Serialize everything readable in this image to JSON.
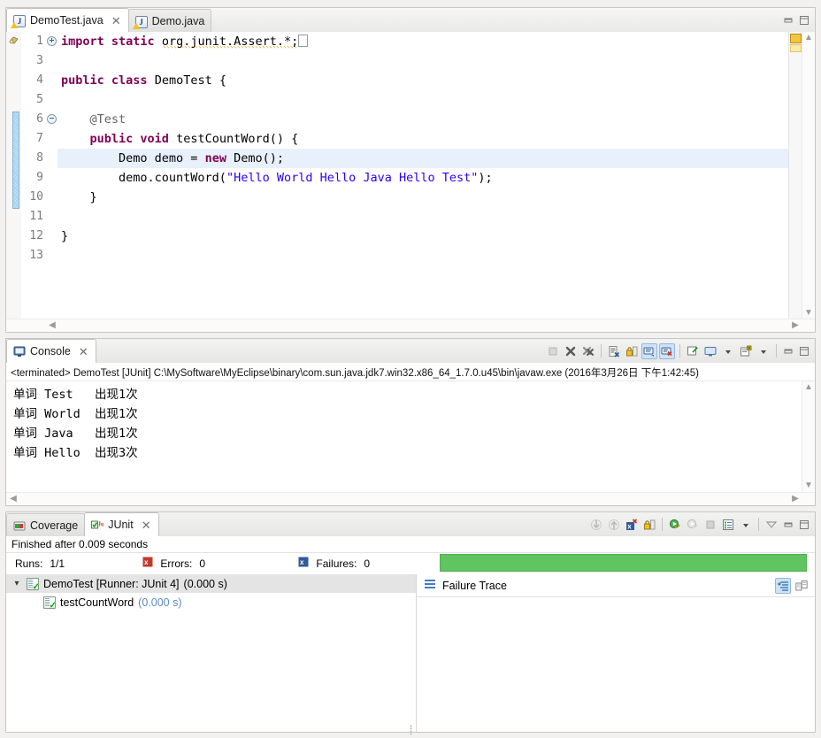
{
  "editor": {
    "tabs": [
      {
        "label": "DemoTest.java",
        "icon": "java-file-warning-icon",
        "active": true,
        "closable": true
      },
      {
        "label": "Demo.java",
        "icon": "java-file-warning-icon",
        "active": false,
        "closable": false
      }
    ],
    "window_buttons": {
      "minimize": "minimize-icon",
      "maximize": "maximize-icon"
    },
    "lines": [
      {
        "num": "1",
        "fold": "plus",
        "tokens": [
          {
            "t": "import ",
            "c": "kw"
          },
          {
            "t": "static ",
            "c": "kw"
          },
          {
            "t": "org.junit.Assert.*;",
            "c": "warn"
          },
          {
            "t": "caret",
            "c": "caret"
          }
        ]
      },
      {
        "num": "3",
        "fold": "",
        "tokens": []
      },
      {
        "num": "4",
        "fold": "",
        "tokens": [
          {
            "t": "public ",
            "c": "kw"
          },
          {
            "t": "class ",
            "c": "kw"
          },
          {
            "t": "DemoTest {",
            "c": "plain"
          }
        ]
      },
      {
        "num": "5",
        "fold": "",
        "tokens": []
      },
      {
        "num": "6",
        "fold": "minus",
        "tokens": [
          {
            "t": "    @Test",
            "c": "ann"
          }
        ]
      },
      {
        "num": "7",
        "fold": "",
        "tokens": [
          {
            "t": "    ",
            "c": "plain"
          },
          {
            "t": "public ",
            "c": "kw"
          },
          {
            "t": "void ",
            "c": "kw"
          },
          {
            "t": "testCountWord() {",
            "c": "plain"
          }
        ]
      },
      {
        "num": "8",
        "fold": "",
        "highlight": true,
        "tokens": [
          {
            "t": "        Demo demo = ",
            "c": "plain"
          },
          {
            "t": "new ",
            "c": "kw"
          },
          {
            "t": "Demo();",
            "c": "plain"
          }
        ]
      },
      {
        "num": "9",
        "fold": "",
        "tokens": [
          {
            "t": "        demo.countWord(",
            "c": "plain"
          },
          {
            "t": "\"Hello World Hello Java Hello Test\"",
            "c": "str"
          },
          {
            "t": ");",
            "c": "plain"
          }
        ]
      },
      {
        "num": "10",
        "fold": "",
        "tokens": [
          {
            "t": "    }",
            "c": "plain"
          }
        ]
      },
      {
        "num": "11",
        "fold": "",
        "tokens": []
      },
      {
        "num": "12",
        "fold": "",
        "tokens": [
          {
            "t": "}",
            "c": "plain"
          }
        ]
      },
      {
        "num": "13",
        "fold": "",
        "tokens": []
      }
    ]
  },
  "console": {
    "tab": {
      "label": "Console",
      "icon": "console-icon",
      "closable": true
    },
    "toolbar": [
      {
        "name": "terminate-all-icon",
        "state": "disabled"
      },
      {
        "name": "remove-launch-icon",
        "state": "enabled"
      },
      {
        "name": "remove-all-terminated-icon",
        "state": "enabled"
      },
      {
        "name": "clear-console-icon",
        "state": "enabled"
      },
      {
        "name": "scroll-lock-icon",
        "state": "enabled"
      },
      {
        "name": "show-console-on-output-icon",
        "state": "toggled"
      },
      {
        "name": "show-console-on-error-icon",
        "state": "toggled"
      },
      {
        "name": "pin-console-icon",
        "state": "enabled"
      },
      {
        "name": "display-selected-console-icon",
        "state": "enabled"
      },
      {
        "name": "display-selected-console-dropdown-icon",
        "state": "enabled"
      },
      {
        "name": "open-console-icon",
        "state": "enabled"
      },
      {
        "name": "open-console-dropdown-icon",
        "state": "enabled"
      },
      {
        "name": "minimize-icon",
        "state": "enabled"
      },
      {
        "name": "maximize-icon",
        "state": "enabled"
      }
    ],
    "header": "<terminated> DemoTest [JUnit] C:\\MySoftware\\MyEclipse\\binary\\com.sun.java.jdk7.win32.x86_64_1.7.0.u45\\bin\\javaw.exe (2016年3月26日 下午1:42:45)",
    "output": [
      "单词 Test   出现1次",
      "单词 World  出现1次",
      "单词 Java   出现1次",
      "单词 Hello  出现3次"
    ]
  },
  "junit": {
    "tabs": [
      {
        "label": "Coverage",
        "icon": "coverage-icon",
        "active": false,
        "closable": false
      },
      {
        "label": "JUnit",
        "icon": "junit-icon",
        "active": true,
        "closable": true
      }
    ],
    "toolbar": [
      {
        "name": "next-failure-icon",
        "state": "disabled"
      },
      {
        "name": "previous-failure-icon",
        "state": "disabled"
      },
      {
        "name": "show-failures-only-icon",
        "state": "enabled"
      },
      {
        "name": "scroll-lock-icon",
        "state": "enabled"
      },
      {
        "name": "rerun-test-icon",
        "state": "enabled"
      },
      {
        "name": "rerun-failed-tests-icon",
        "state": "disabled"
      },
      {
        "name": "stop-icon",
        "state": "disabled"
      },
      {
        "name": "test-run-history-icon",
        "state": "enabled"
      },
      {
        "name": "test-run-history-dropdown-icon",
        "state": "enabled"
      },
      {
        "name": "view-menu-icon",
        "state": "enabled"
      },
      {
        "name": "minimize-icon",
        "state": "enabled"
      },
      {
        "name": "maximize-icon",
        "state": "enabled"
      }
    ],
    "status": "Finished after 0.009 seconds",
    "counters": {
      "runs_label": "Runs:",
      "runs_value": "1/1",
      "errors_label": "Errors:",
      "errors_value": "0",
      "failures_label": "Failures:",
      "failures_value": "0",
      "progress_color": "#60c460"
    },
    "tree": [
      {
        "label": "DemoTest [Runner: JUnit 4]",
        "time": "(0.000 s)",
        "selected": true,
        "expanded": true,
        "depth": 0
      },
      {
        "label": "testCountWord",
        "time": "(0.000 s)",
        "selected": false,
        "expanded": false,
        "depth": 1
      }
    ],
    "failure_trace": {
      "title": "Failure Trace",
      "buttons": [
        {
          "name": "filter-stack-trace-icon",
          "state": "toggled"
        },
        {
          "name": "compare-result-icon",
          "state": "enabled"
        }
      ]
    }
  }
}
